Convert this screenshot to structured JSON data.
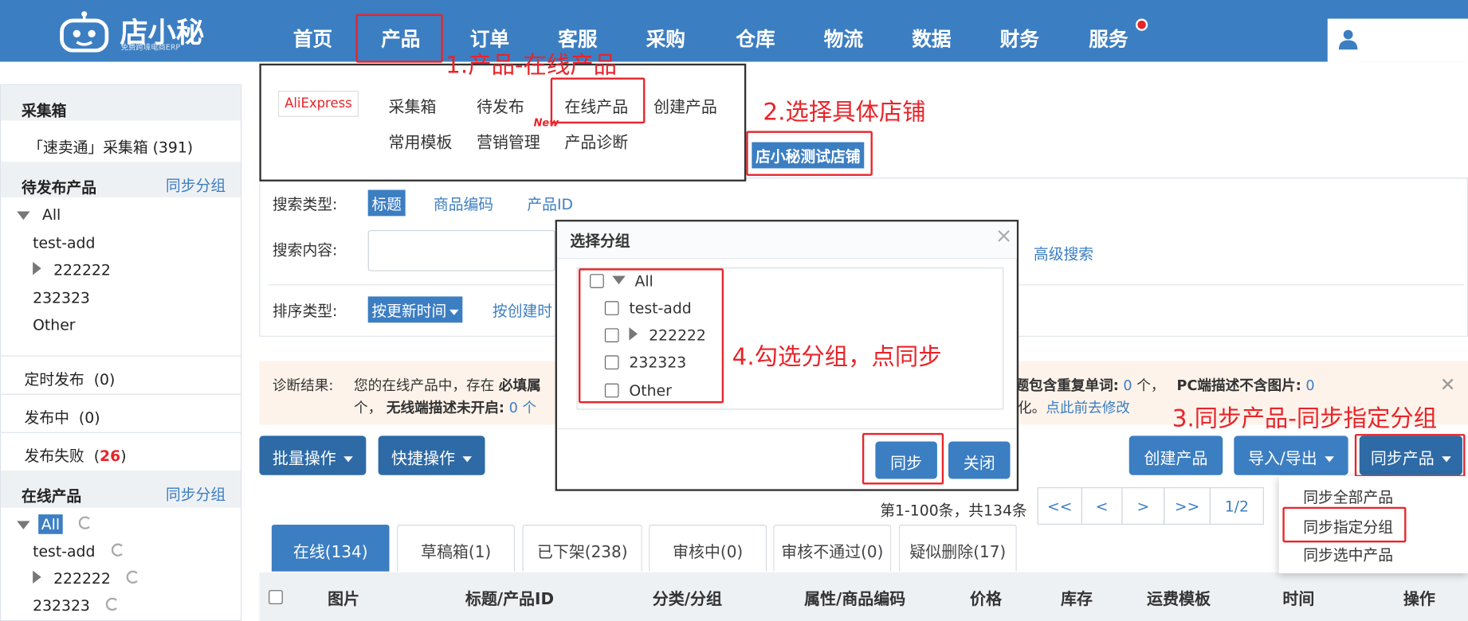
{
  "app": {
    "logo_text": "店小秘",
    "logo_sub": "免费跨境电商ERP"
  },
  "nav": [
    "首页",
    "产品",
    "订单",
    "客服",
    "采购",
    "仓库",
    "物流",
    "数据",
    "财务",
    "服务"
  ],
  "sidebar": {
    "sections": [
      {
        "title": "采集箱"
      },
      {
        "title": "待发布产品",
        "action": "同步分组"
      },
      {
        "title": "在线产品",
        "action": "同步分组"
      }
    ],
    "collect_box": "「速卖通」采集箱 (391)",
    "tree_pending": [
      "All",
      "test-add",
      "222222",
      "232323",
      "Other"
    ],
    "status_items": [
      {
        "label": "定时发布",
        "count": "(0)"
      },
      {
        "label": "发布中",
        "count": "(0)"
      },
      {
        "label": "发布失败",
        "count_pre": "(",
        "count": "26",
        "count_post": ")"
      }
    ],
    "tree_online": [
      "All",
      "test-add",
      "222222",
      "232323"
    ]
  },
  "dropdown": {
    "brand": "AliExpress",
    "row1": [
      "采集箱",
      "待发布",
      "在线产品",
      "创建产品"
    ],
    "row2": [
      "常用模板",
      "营销管理",
      "产品诊断"
    ],
    "new_badge": "New"
  },
  "store_chip": "店小秘测试店铺",
  "search": {
    "type_label": "搜索类型:",
    "types": [
      "标题",
      "商品编码",
      "产品ID"
    ],
    "content_label": "搜索内容:",
    "advanced": "高级搜索",
    "sort_label": "排序类型:",
    "sort_selected": "按更新时间",
    "sort_other": "按创建时"
  },
  "diagnosis": {
    "label": "诊断结果:",
    "line1_a": "您的在线产品中，存在",
    "line1_b": "必填属",
    "line1_right_a": "题包含重复单词:",
    "line1_right_n1": "0",
    "line1_right_b": "个，",
    "line1_right_c": "PC端描述不含图片:",
    "line1_right_n2": "0",
    "line2_a": "个，",
    "line2_b": "无线端描述未开启:",
    "line2_n": "0 个",
    "line2_right_a": "化。",
    "line2_right_link": "点此前去修改"
  },
  "buttons": {
    "batch": "批量操作",
    "quick": "快捷操作",
    "create": "创建产品",
    "import_export": "导入/导出",
    "sync": "同步产品"
  },
  "sync_menu": [
    "同步全部产品",
    "同步指定分组",
    "同步选中产品"
  ],
  "pagination": {
    "summary": "第1-100条，共134条",
    "first": "<<",
    "prev": "<",
    "next": ">",
    "last": ">>",
    "page": "1/2"
  },
  "tabs": [
    "在线(134)",
    "草稿箱(1)",
    "已下架(238)",
    "审核中(0)",
    "审核不通过(0)",
    "疑似删除(17)"
  ],
  "table_headers": [
    "图片",
    "标题/产品ID",
    "分类/分组",
    "属性/商品编码",
    "价格",
    "库存",
    "运费模板",
    "时间",
    "操作"
  ],
  "modal": {
    "title": "选择分组",
    "close_glyph": "×",
    "groups": [
      "All",
      "test-add",
      "222222",
      "232323",
      "Other"
    ],
    "confirm": "同步",
    "cancel": "关闭"
  },
  "annotations": {
    "a1": "1.产品-在线产品",
    "a2": "2.选择具体店铺",
    "a3": "3.同步产品-同步指定分组",
    "a4": "4.勾选分组，点同步"
  },
  "colors": {
    "brand_blue": "#3c7ec2",
    "button_blue": "#2d6aa6",
    "annotation_red": "#e8242a"
  }
}
